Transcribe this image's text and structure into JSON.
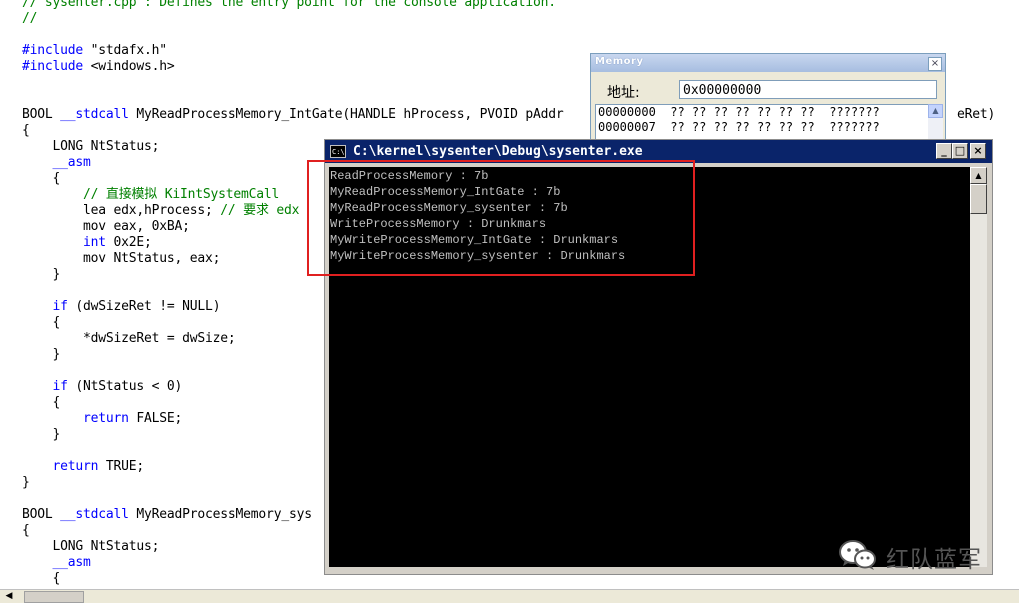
{
  "editor": {
    "lines": [
      {
        "parts": [
          {
            "t": "// sysenter.cpp : Defines the entry point for the console application.",
            "c": "cm"
          }
        ]
      },
      {
        "parts": [
          {
            "t": "//",
            "c": "cm"
          }
        ]
      },
      {
        "parts": []
      },
      {
        "parts": [
          {
            "t": "#include",
            "c": "pp"
          },
          {
            "t": " \"stdafx.h\"",
            "c": ""
          }
        ]
      },
      {
        "parts": [
          {
            "t": "#include",
            "c": "pp"
          },
          {
            "t": " <windows.h>",
            "c": ""
          }
        ]
      },
      {
        "parts": []
      },
      {
        "parts": []
      },
      {
        "parts": [
          {
            "t": "BOOL ",
            "c": ""
          },
          {
            "t": "__stdcall",
            "c": "kw"
          },
          {
            "t": " MyReadProcessMemory_IntGate(HANDLE hProcess, PVOID pAddr",
            "c": ""
          }
        ]
      },
      {
        "parts": [
          {
            "t": "{",
            "c": ""
          }
        ]
      },
      {
        "parts": [
          {
            "t": "    LONG NtStatus;",
            "c": ""
          }
        ]
      },
      {
        "parts": [
          {
            "t": "    ",
            "c": ""
          },
          {
            "t": "__asm",
            "c": "kw"
          }
        ]
      },
      {
        "parts": [
          {
            "t": "    {",
            "c": ""
          }
        ]
      },
      {
        "parts": [
          {
            "t": "        ",
            "c": ""
          },
          {
            "t": "// 直接模拟 KiIntSystemCall",
            "c": "cm"
          }
        ]
      },
      {
        "parts": [
          {
            "t": "        lea edx,hProcess; ",
            "c": ""
          },
          {
            "t": "// 要求 edx",
            "c": "cm"
          }
        ]
      },
      {
        "parts": [
          {
            "t": "        mov eax, 0xBA;",
            "c": ""
          }
        ]
      },
      {
        "parts": [
          {
            "t": "        ",
            "c": ""
          },
          {
            "t": "int",
            "c": "kw"
          },
          {
            "t": " 0x2E;",
            "c": ""
          }
        ]
      },
      {
        "parts": [
          {
            "t": "        mov NtStatus, eax;",
            "c": ""
          }
        ]
      },
      {
        "parts": [
          {
            "t": "    }",
            "c": ""
          }
        ]
      },
      {
        "parts": []
      },
      {
        "parts": [
          {
            "t": "    ",
            "c": ""
          },
          {
            "t": "if",
            "c": "kw"
          },
          {
            "t": " (dwSizeRet != NULL)",
            "c": ""
          }
        ]
      },
      {
        "parts": [
          {
            "t": "    {",
            "c": ""
          }
        ]
      },
      {
        "parts": [
          {
            "t": "        *dwSizeRet = dwSize;",
            "c": ""
          }
        ]
      },
      {
        "parts": [
          {
            "t": "    }",
            "c": ""
          }
        ]
      },
      {
        "parts": []
      },
      {
        "parts": [
          {
            "t": "    ",
            "c": ""
          },
          {
            "t": "if",
            "c": "kw"
          },
          {
            "t": " (NtStatus < 0)",
            "c": ""
          }
        ]
      },
      {
        "parts": [
          {
            "t": "    {",
            "c": ""
          }
        ]
      },
      {
        "parts": [
          {
            "t": "        ",
            "c": ""
          },
          {
            "t": "return",
            "c": "kw"
          },
          {
            "t": " FALSE;",
            "c": ""
          }
        ]
      },
      {
        "parts": [
          {
            "t": "    }",
            "c": ""
          }
        ]
      },
      {
        "parts": []
      },
      {
        "parts": [
          {
            "t": "    ",
            "c": ""
          },
          {
            "t": "return",
            "c": "kw"
          },
          {
            "t": " TRUE;",
            "c": ""
          }
        ]
      },
      {
        "parts": [
          {
            "t": "}",
            "c": ""
          }
        ]
      },
      {
        "parts": []
      },
      {
        "parts": [
          {
            "t": "BOOL ",
            "c": ""
          },
          {
            "t": "__stdcall",
            "c": "kw"
          },
          {
            "t": " MyReadProcessMemory_sys",
            "c": ""
          }
        ]
      },
      {
        "parts": [
          {
            "t": "{",
            "c": ""
          }
        ]
      },
      {
        "parts": [
          {
            "t": "    LONG NtStatus;",
            "c": ""
          }
        ]
      },
      {
        "parts": [
          {
            "t": "    ",
            "c": ""
          },
          {
            "t": "__asm",
            "c": "kw"
          }
        ]
      },
      {
        "parts": [
          {
            "t": "    {",
            "c": ""
          }
        ]
      }
    ],
    "line_right_fragment": "eRet)"
  },
  "memory": {
    "title": "Memory",
    "address_label": "地址:",
    "address_value": "0x00000000",
    "rows": [
      "00000000  ?? ?? ?? ?? ?? ?? ??  ???????",
      "00000007  ?? ?? ?? ?? ?? ?? ??  ???????"
    ],
    "close_glyph": "×",
    "scroll_up_glyph": "▲"
  },
  "console": {
    "title": "C:\\kernel\\sysenter\\Debug\\sysenter.exe",
    "icon_text": "C:\\",
    "buttons": {
      "minimize": "_",
      "maximize": "□",
      "close": "×"
    },
    "scroll_up_glyph": "▲",
    "output": [
      "ReadProcessMemory : 7b",
      "MyReadProcessMemory_IntGate : 7b",
      "MyReadProcessMemory_sysenter : 7b",
      "WriteProcessMemory : Drunkmars",
      "MyWriteProcessMemory_IntGate : Drunkmars",
      "MyWriteProcessMemory_sysenter : Drunkmars"
    ]
  },
  "hscroll": {
    "left_glyph": "◀"
  },
  "watermark": {
    "text": "红队蓝军"
  },
  "colors": {
    "highlight": "#e02020",
    "console_titlebar": "#0a246a",
    "keyword": "#0000ff",
    "comment": "#008000"
  }
}
